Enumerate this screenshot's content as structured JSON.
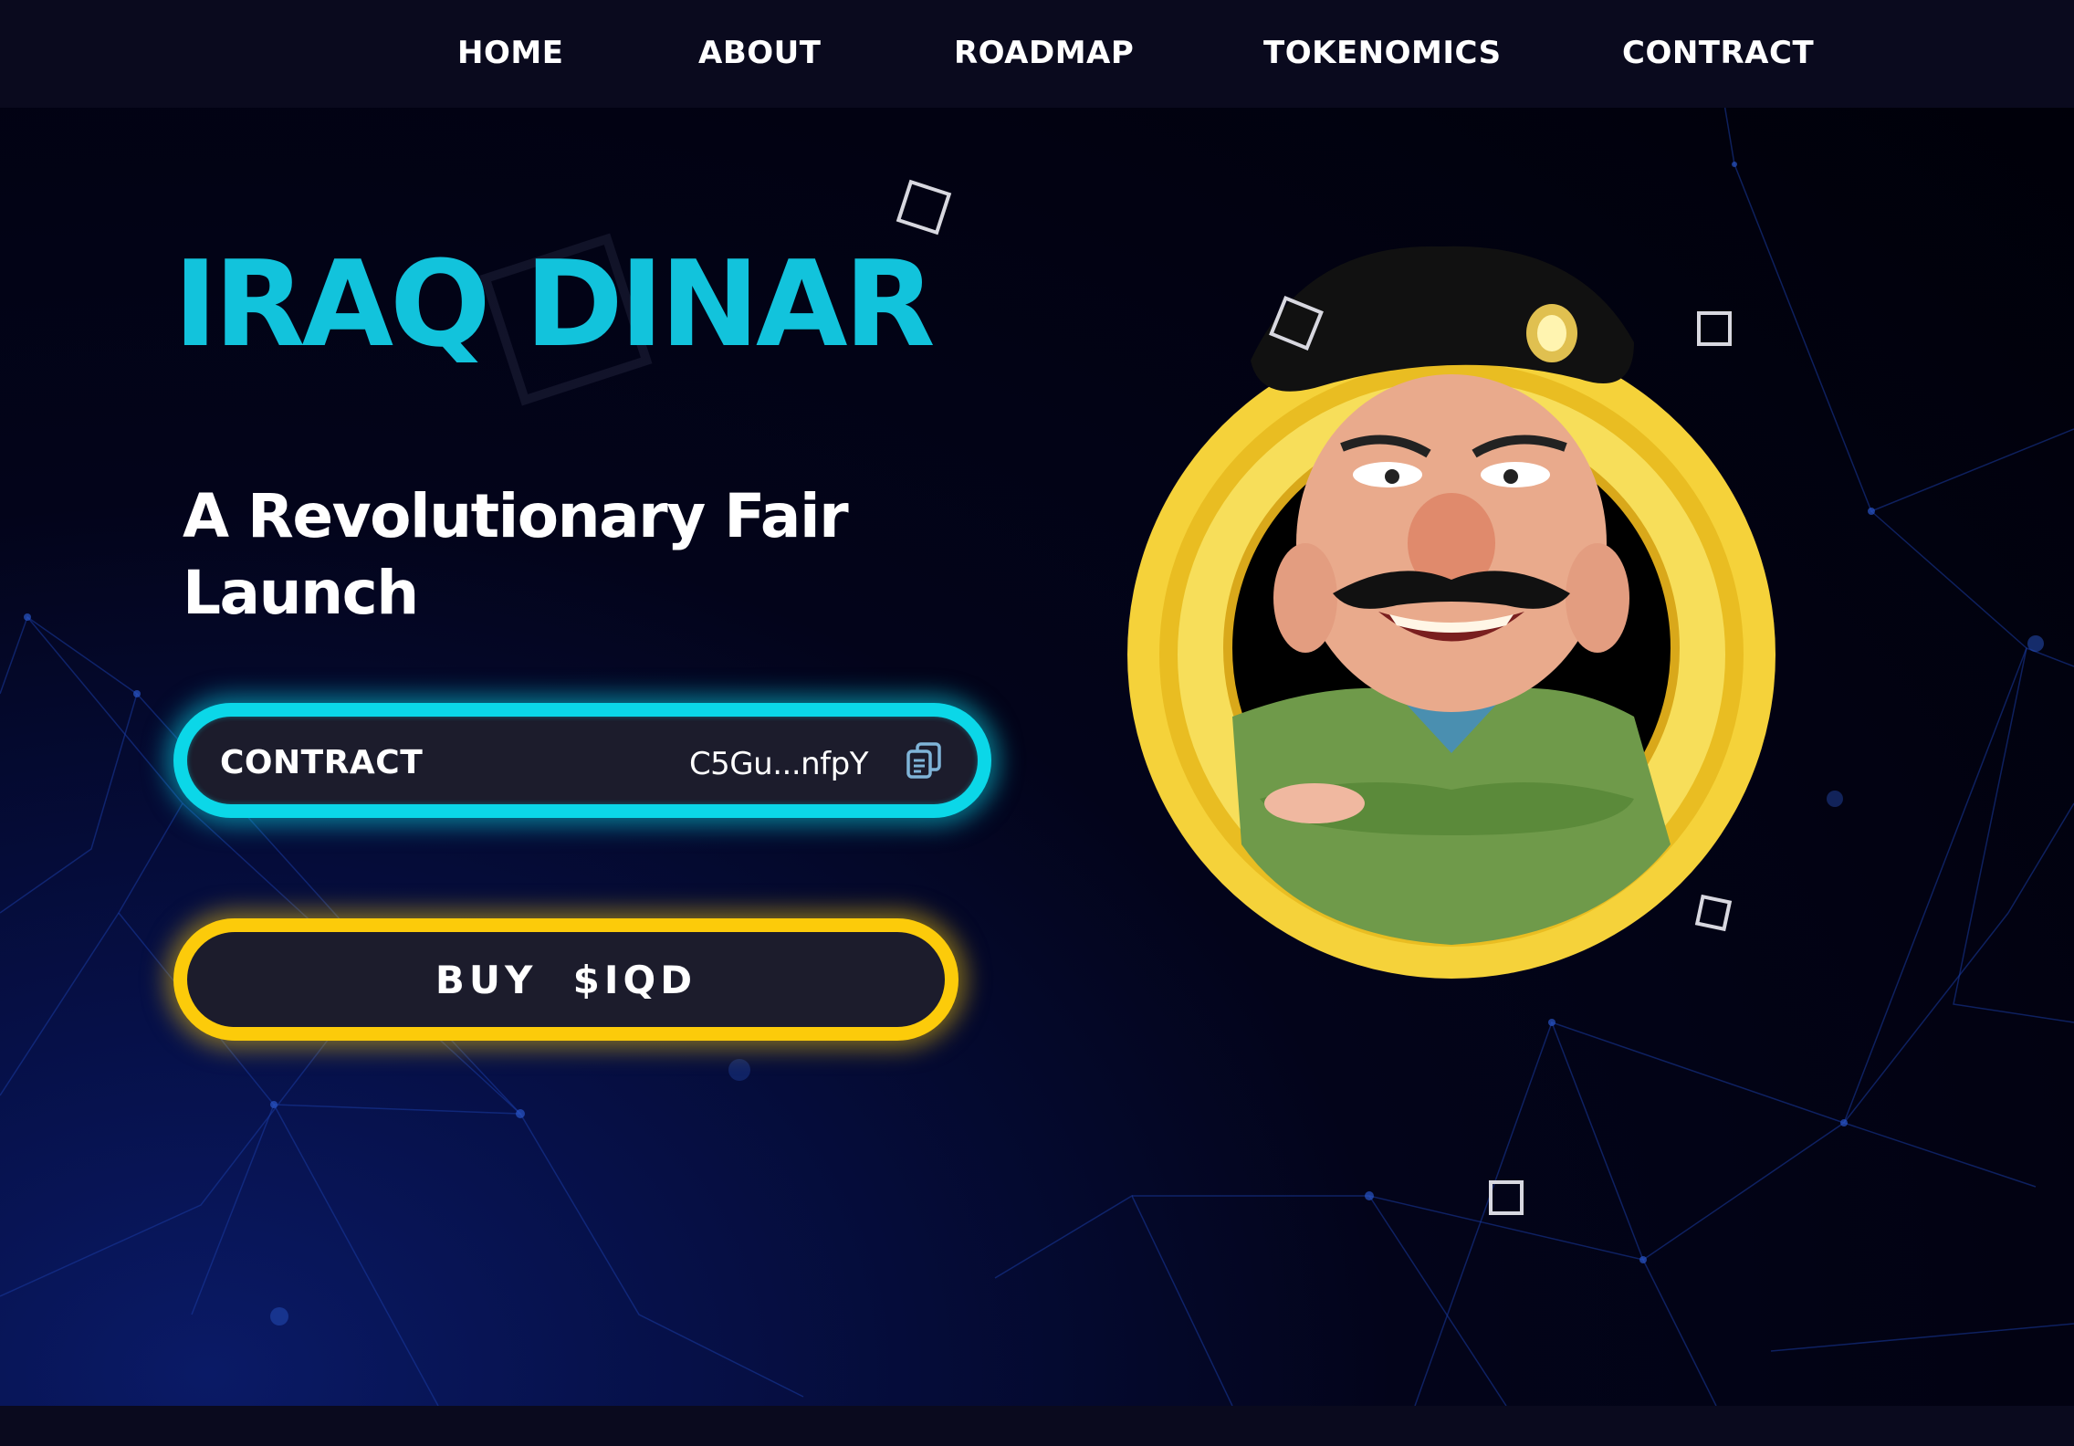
{
  "nav": {
    "items": [
      {
        "label": "HOME"
      },
      {
        "label": "ABOUT"
      },
      {
        "label": "ROADMAP"
      },
      {
        "label": "TOKENOMICS"
      },
      {
        "label": "CONTRACT"
      }
    ]
  },
  "hero": {
    "title": "IRAQ DINAR",
    "subtitle": "A Revolutionary Fair Launch"
  },
  "contract": {
    "label": "CONTRACT",
    "address": "C5Gu...nfpY",
    "copy_icon": "copy-icon"
  },
  "buy": {
    "label": "BUY  $IQD"
  },
  "colors": {
    "accent_cyan": "#12c3dc",
    "accent_yellow": "#fccb0a",
    "background": "#05051a",
    "nav_background": "#0a0a1e"
  },
  "icons": [
    "copy-icon",
    "coin-mascot-logo",
    "square-decoration"
  ]
}
